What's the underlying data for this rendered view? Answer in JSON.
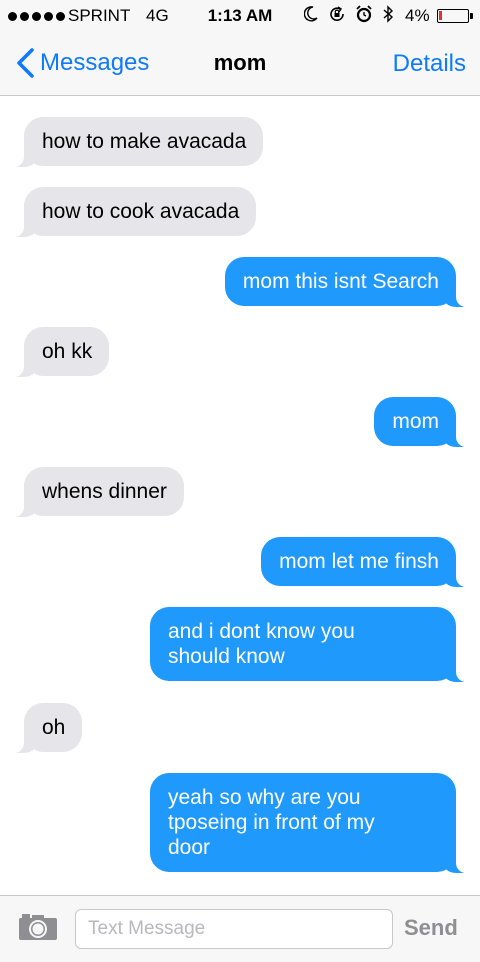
{
  "status_bar": {
    "carrier": "SPRINT",
    "network": "4G",
    "time": "1:13 AM",
    "battery_percent": "4%",
    "icons": [
      "moon-icon",
      "rotation-lock-icon",
      "alarm-icon",
      "bluetooth-icon",
      "battery-icon"
    ],
    "signal_bars": 5,
    "battery_level": 0.04
  },
  "nav": {
    "back_label": "Messages",
    "title": "mom",
    "details_label": "Details"
  },
  "messages": [
    {
      "direction": "incoming",
      "text": "how to make avacada"
    },
    {
      "direction": "incoming",
      "text": "how to cook avacada"
    },
    {
      "direction": "outgoing",
      "text": "mom this isnt Search"
    },
    {
      "direction": "incoming",
      "text": "oh kk"
    },
    {
      "direction": "outgoing",
      "text": "mom"
    },
    {
      "direction": "incoming",
      "text": "whens dinner"
    },
    {
      "direction": "outgoing",
      "text": "mom let me finsh"
    },
    {
      "direction": "outgoing",
      "text": "and i dont know you\nshould know"
    },
    {
      "direction": "incoming",
      "text": "oh"
    },
    {
      "direction": "outgoing",
      "text": "yeah so why are you\ntposeing in front of my\ndoor"
    }
  ],
  "composer": {
    "placeholder": "Text Message",
    "value": "",
    "send_label": "Send"
  },
  "colors": {
    "accent": "#0e7afe",
    "outgoing_bubble": "#1f99fb",
    "incoming_bubble": "#e5e5ea",
    "battery_low": "#e8302a"
  }
}
